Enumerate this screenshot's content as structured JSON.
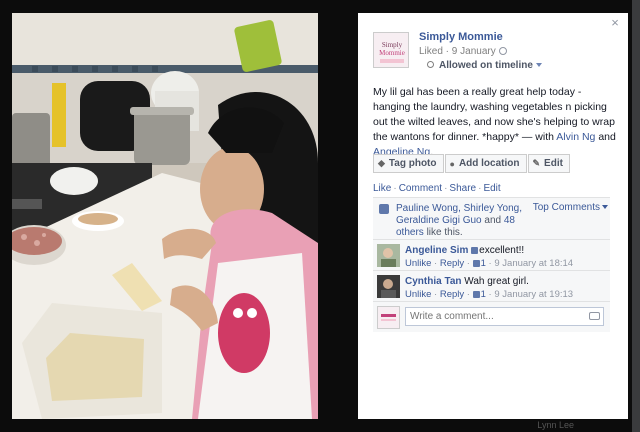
{
  "background": {
    "bottom_name": "Lynn Lee"
  },
  "viewer": {
    "close_label": "×"
  },
  "post": {
    "page_name": "Simply Mommie",
    "avatar_text": "Simply Mommie",
    "liked_label": "Liked",
    "date": "9 January",
    "meta_separator": " · ",
    "audience_label": "Allowed on timeline",
    "caption_text": "My lil gal has been a really great help today - hanging the laundry, washing vegetables n picking out the wilted leaves, and now she's helping to wrap the wantons for dinner. *happy*",
    "with_prefix": " — with ",
    "tag_1": "Alvin Ng",
    "and_label": " and ",
    "tag_2": "Angeline Ng",
    "end_punct": "."
  },
  "actions": {
    "tag_photo": "Tag photo",
    "add_location": "Add location",
    "edit": "Edit"
  },
  "ufi_links": {
    "like": "Like",
    "comment": "Comment",
    "share": "Share",
    "edit": "Edit",
    "separator": "·"
  },
  "likes": {
    "names": "Pauline Wong, Shirley Yong, Geraldine Gigi Guo",
    "and_label": " and ",
    "others": "48 others",
    "suffix": " like this.",
    "top_comments": "Top Comments"
  },
  "comments": [
    {
      "author": "Angeline Sim",
      "text": "excellent!!",
      "unlike": "Unlike",
      "reply": "Reply",
      "likes": "1",
      "time": "9 January at 18:14"
    },
    {
      "author": "Cynthia Tan",
      "text": "Wah great girl.",
      "unlike": "Unlike",
      "reply": "Reply",
      "likes": "1",
      "time": "9 January at 19:13"
    }
  ],
  "composer": {
    "placeholder": "Write a comment..."
  },
  "colors": {
    "link": "#3b5998",
    "panel_bg": "#ffffff",
    "ufi_bg": "#f6f7f8"
  }
}
